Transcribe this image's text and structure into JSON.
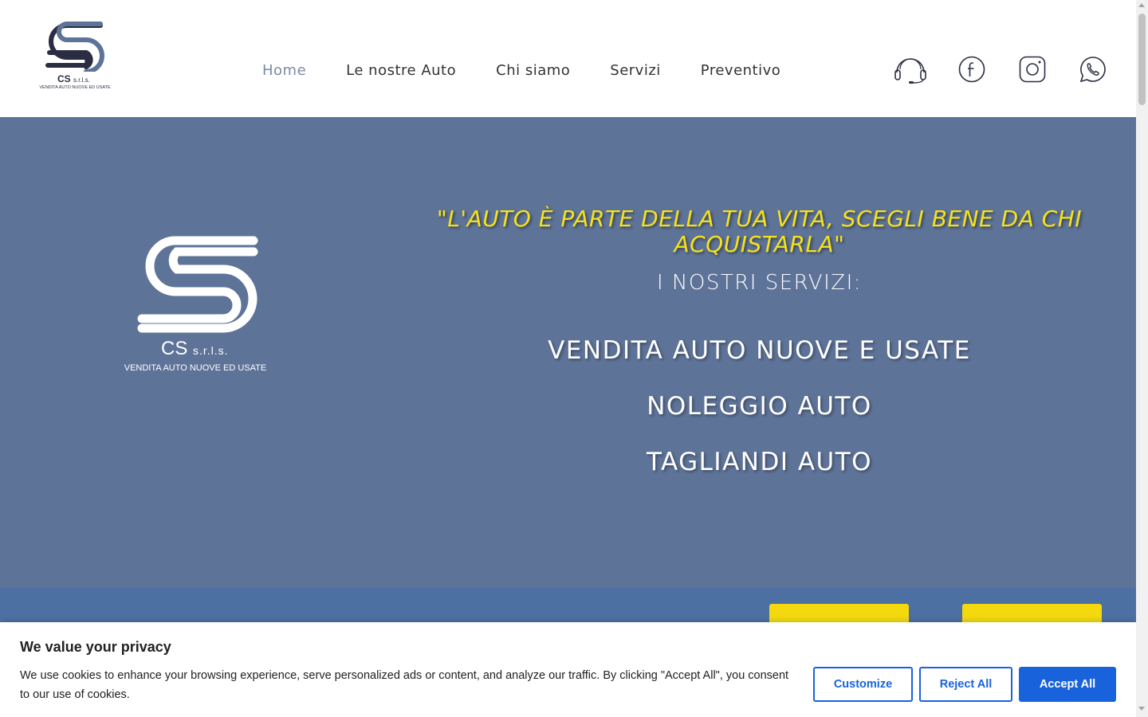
{
  "header": {
    "logo": {
      "name": "CS",
      "suffix": "s.r.l.s.",
      "tagline": "VENDITA AUTO NUOVE ED USATE"
    },
    "nav": [
      {
        "label": "Home",
        "active": true
      },
      {
        "label": "Le nostre Auto",
        "active": false
      },
      {
        "label": "Chi siamo",
        "active": false
      },
      {
        "label": "Servizi",
        "active": false
      },
      {
        "label": "Preventivo",
        "active": false
      }
    ],
    "social_icons": [
      "headset-icon",
      "facebook-icon",
      "instagram-icon",
      "whatsapp-icon"
    ]
  },
  "hero": {
    "logo": {
      "name": "CS",
      "suffix": "s.r.l.s.",
      "tagline": "VENDITA AUTO NUOVE ED USATE"
    },
    "quote": "\"L'AUTO È PARTE DELLA TUA VITA, SCEGLI BENE DA CHI ACQUISTARLA\"",
    "services_title": "I NOSTRI SERVIZI:",
    "services": [
      "VENDITA AUTO NUOVE E USATE",
      "NOLEGGIO AUTO",
      "TAGLIANDI AUTO"
    ]
  },
  "cookie": {
    "title": "We value your privacy",
    "text": "We use cookies to enhance your browsing experience, serve personalized ads or content, and analyze our traffic. By clicking \"Accept All\", you consent to our use of cookies.",
    "customize_label": "Customize",
    "reject_label": "Reject All",
    "accept_label": "Accept All"
  },
  "colors": {
    "hero_bg": "#5e7398",
    "strip_bg": "#4d70a3",
    "quote_yellow": "#f5e21b",
    "button_yellow": "#f5d90f",
    "cookie_blue": "#1863dc",
    "nav_active": "#7a8aa6",
    "logo_dark": "#2b2d42"
  }
}
